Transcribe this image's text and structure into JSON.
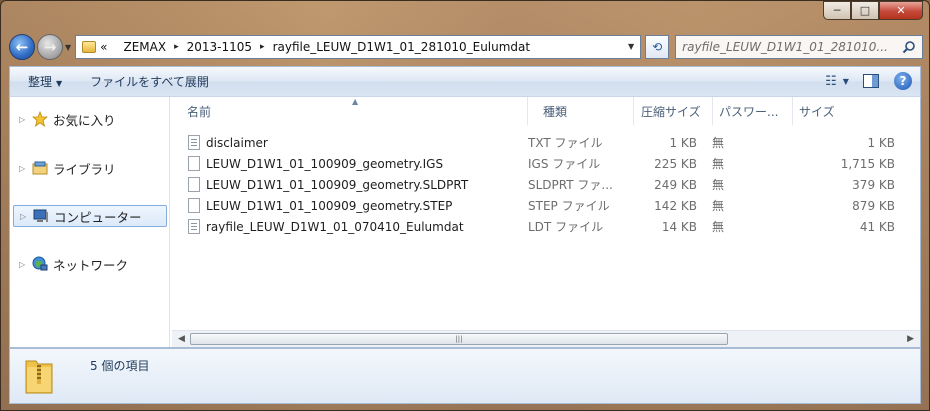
{
  "window": {
    "minimize": "─",
    "maximize": "□",
    "close": "✕"
  },
  "address": {
    "crumbs": [
      "«",
      "ZEMAX",
      "2013-1105",
      "rayfile_LEUW_D1W1_01_281010_Eulumdat"
    ],
    "separator": "▸"
  },
  "search": {
    "placeholder": "rayfile_LEUW_D1W1_01_281010..."
  },
  "toolbar": {
    "organize": "整理",
    "expand_all": "ファイルをすべて展開"
  },
  "sidebar": {
    "items": [
      {
        "label": "お気に入り",
        "icon": "star-icon"
      },
      {
        "label": "ライブラリ",
        "icon": "library-icon"
      },
      {
        "label": "コンピューター",
        "icon": "computer-icon",
        "selected": true
      },
      {
        "label": "ネットワーク",
        "icon": "network-icon"
      }
    ]
  },
  "columns": {
    "name": "名前",
    "type": "種類",
    "compressed_size": "圧縮サイズ",
    "password": "パスワー...",
    "size": "サイズ"
  },
  "files": [
    {
      "name": "disclaimer",
      "type": "TXT ファイル",
      "compressed_size": "1 KB",
      "password": "無",
      "size": "1 KB",
      "icon": "text-file-icon"
    },
    {
      "name": "LEUW_D1W1_01_100909_geometry.IGS",
      "type": "IGS ファイル",
      "compressed_size": "225 KB",
      "password": "無",
      "size": "1,715 KB",
      "icon": "file-icon"
    },
    {
      "name": "LEUW_D1W1_01_100909_geometry.SLDPRT",
      "type": "SLDPRT ファ...",
      "compressed_size": "249 KB",
      "password": "無",
      "size": "379 KB",
      "icon": "file-icon"
    },
    {
      "name": "LEUW_D1W1_01_100909_geometry.STEP",
      "type": "STEP ファイル",
      "compressed_size": "142 KB",
      "password": "無",
      "size": "879 KB",
      "icon": "file-icon"
    },
    {
      "name": "rayfile_LEUW_D1W1_01_070410_Eulumdat",
      "type": "LDT ファイル",
      "compressed_size": "14 KB",
      "password": "無",
      "size": "41 KB",
      "icon": "text-file-icon"
    }
  ],
  "status": {
    "item_count": "5 個の項目"
  }
}
